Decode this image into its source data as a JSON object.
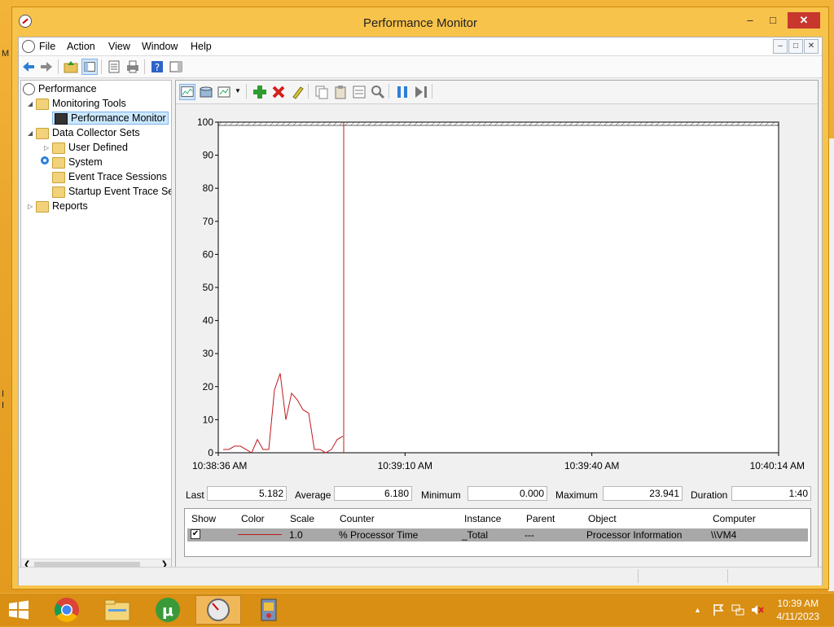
{
  "window": {
    "title": "Performance Monitor",
    "min": "–",
    "max": "□",
    "close": "✕"
  },
  "desktop": {
    "edge_letters": [
      "M",
      "I",
      "I"
    ]
  },
  "menu": {
    "items": [
      "File",
      "Action",
      "View",
      "Window",
      "Help"
    ],
    "mdi": [
      "–",
      "□",
      "✕"
    ]
  },
  "tree": {
    "root": "Performance",
    "monitoring_tools": "Monitoring Tools",
    "performance_monitor": "Performance Monitor",
    "data_collector_sets": "Data Collector Sets",
    "user_defined": "User Defined",
    "system": "System",
    "event_trace": "Event Trace Sessions",
    "startup_event_trace": "Startup Event Trace Ses",
    "reports": "Reports"
  },
  "stats": {
    "last_label": "Last",
    "last": "5.182",
    "average_label": "Average",
    "average": "6.180",
    "minimum_label": "Minimum",
    "minimum": "0.000",
    "maximum_label": "Maximum",
    "maximum": "23.941",
    "duration_label": "Duration",
    "duration": "1:40"
  },
  "legend": {
    "headers": [
      "Show",
      "Color",
      "Scale",
      "Counter",
      "Instance",
      "Parent",
      "Object",
      "Computer"
    ],
    "row": {
      "show": "✔",
      "scale": "1.0",
      "counter": "% Processor Time",
      "instance": "_Total",
      "parent": "---",
      "object": "Processor Information",
      "computer": "\\\\VM4"
    }
  },
  "chart_data": {
    "type": "line",
    "series": [
      {
        "values": [
          1,
          1,
          2,
          2,
          1,
          0,
          4,
          1,
          1,
          19,
          24,
          10,
          18,
          16,
          13,
          12,
          1,
          1,
          0,
          1,
          4,
          5
        ]
      }
    ],
    "x_tick_labels": [
      "10:38:36 AM",
      "10:39:10 AM",
      "10:39:40 AM",
      "10:40:14 AM"
    ],
    "ylim": [
      0,
      100
    ],
    "y_ticks": [
      0,
      10,
      20,
      30,
      40,
      50,
      60,
      70,
      80,
      90,
      100
    ],
    "grid": false,
    "line_color": "#c0181e"
  },
  "taskbar": {
    "time": "10:39 AM",
    "date": "4/11/2023"
  }
}
